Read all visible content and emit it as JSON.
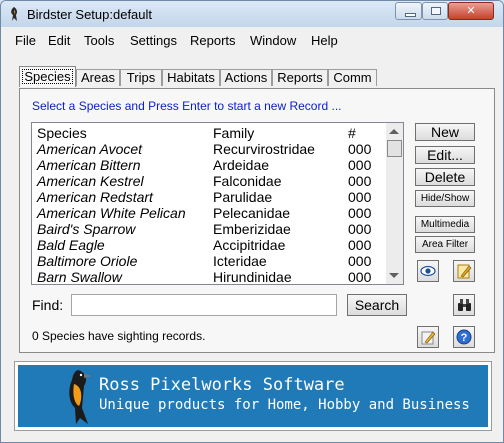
{
  "window": {
    "title": "Birdster Setup:default",
    "minimize_label": "—",
    "maximize_label": "□",
    "close_label": "✕"
  },
  "menu": [
    "File",
    "Edit",
    "Tools",
    "Settings",
    "Reports",
    "Window",
    "Help"
  ],
  "tabs": [
    "Species",
    "Areas",
    "Trips",
    "Habitats",
    "Actions",
    "Reports",
    "Comm"
  ],
  "instruction": "Select a Species and Press Enter to start a new Record ...",
  "species_list": {
    "columns": [
      "Species",
      "Family",
      "#"
    ],
    "rows": [
      [
        "American Avocet",
        "Recurvirostridae",
        "000"
      ],
      [
        "American Bittern",
        "Ardeidae",
        "000"
      ],
      [
        "American Kestrel",
        "Falconidae",
        "000"
      ],
      [
        "American Redstart",
        "Parulidae",
        "000"
      ],
      [
        "American White Pelican",
        "Pelecanidae",
        "000"
      ],
      [
        "Baird's Sparrow",
        "Emberizidae",
        "000"
      ],
      [
        "Bald Eagle",
        "Accipitridae",
        "000"
      ],
      [
        "Baltimore Oriole",
        "Icteridae",
        "000"
      ],
      [
        "Barn Swallow",
        "Hirundinidae",
        "000"
      ]
    ]
  },
  "buttons": {
    "new": "New",
    "edit": "Edit...",
    "delete": "Delete",
    "hide_show": "Hide/Show",
    "multimedia": "Multimedia",
    "area_filter": "Area Filter",
    "search": "Search"
  },
  "find": {
    "label": "Find:",
    "value": ""
  },
  "status": "0 Species have sighting records.",
  "banner": {
    "line1": "Ross Pixelworks Software",
    "line2": "Unique products for Home, Hobby and Business"
  },
  "colors": {
    "instruction": "#0a1ec8",
    "banner_bg": "#1f7ab7",
    "titlebar": "#c4d6ea"
  }
}
